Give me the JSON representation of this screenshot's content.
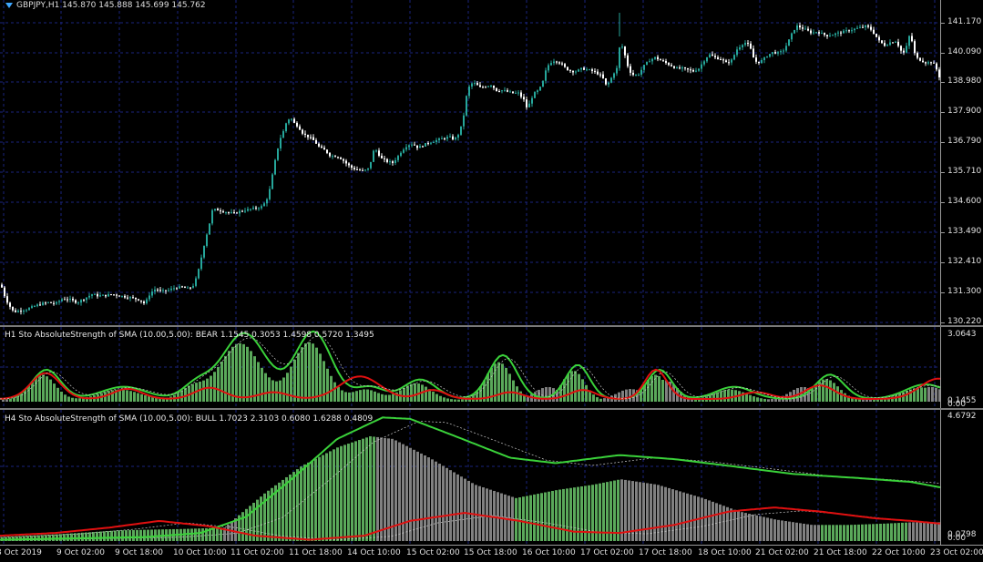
{
  "main_chart": {
    "symbol_line": "GBPJPY,H1  145.870 145.888 145.699 145.762",
    "price_ticks": [
      "141.170",
      "140.090",
      "138.980",
      "137.900",
      "136.790",
      "135.710",
      "134.600",
      "133.490",
      "132.410",
      "131.300",
      "130.220"
    ],
    "price_range": [
      130.1,
      141.9
    ]
  },
  "indicator_h1": {
    "label": "H1 Sto AbsoluteStrength of SMA (10.00,5.00): BEAR 1.1545 0.3053 1.4598 0.5720 1.3495",
    "ticks": [
      "3.0643",
      "0.1455",
      "0.00"
    ],
    "range": [
      0,
      3.0643
    ]
  },
  "indicator_h4": {
    "label": "H4 Sto AbsoluteStrength of SMA (10.00,5.00): BULL 1.7023 2.3103 0.6080 1.6288 0.4809",
    "ticks": [
      "4.6792",
      "0.0798",
      "0.00"
    ],
    "range": [
      0,
      4.6792
    ]
  },
  "time_axis": [
    "8 Oct 2019",
    "9 Oct 02:00",
    "9 Oct 18:00",
    "10 Oct 10:00",
    "11 Oct 02:00",
    "11 Oct 18:00",
    "14 Oct 10:00",
    "15 Oct 02:00",
    "15 Oct 18:00",
    "16 Oct 10:00",
    "17 Oct 02:00",
    "17 Oct 18:00",
    "18 Oct 10:00",
    "21 Oct 02:00",
    "21 Oct 18:00",
    "22 Oct 10:00",
    "23 Oct 02:00"
  ],
  "colors": {
    "background": "#000000",
    "grid": "#1a237e",
    "bull_candle": "#26a69a",
    "bear_candle": "#ffffff",
    "green_hist": "#5aa85a",
    "gray_hist": "#808080",
    "green_line": "#3ad13a",
    "red_line": "#e01010"
  },
  "chart_data": {
    "type": "candlestick",
    "title": "GBPJPY,H1",
    "ohlc_last": {
      "open": 145.87,
      "high": 145.888,
      "low": 145.699,
      "close": 145.762
    },
    "y_axis_ticks": [
      141.17,
      140.09,
      138.98,
      137.9,
      136.79,
      135.71,
      134.6,
      133.49,
      132.41,
      131.3,
      130.22
    ],
    "x_axis_ticks": [
      "8 Oct 2019",
      "9 Oct 02:00",
      "9 Oct 18:00",
      "10 Oct 10:00",
      "11 Oct 02:00",
      "11 Oct 18:00",
      "14 Oct 10:00",
      "15 Oct 02:00",
      "15 Oct 18:00",
      "16 Oct 10:00",
      "17 Oct 02:00",
      "17 Oct 18:00",
      "18 Oct 10:00",
      "21 Oct 02:00",
      "21 Oct 18:00",
      "22 Oct 10:00",
      "23 Oct 02:00"
    ],
    "close_path": [
      [
        0,
        131.6
      ],
      [
        4,
        131.2
      ],
      [
        8,
        130.9
      ],
      [
        14,
        130.6
      ],
      [
        20,
        130.65
      ],
      [
        28,
        130.7
      ],
      [
        36,
        130.8
      ],
      [
        44,
        130.9
      ],
      [
        52,
        130.95
      ],
      [
        60,
        130.9
      ],
      [
        68,
        131.1
      ],
      [
        76,
        131.05
      ],
      [
        84,
        130.95
      ],
      [
        92,
        131.1
      ],
      [
        100,
        131.25
      ],
      [
        106,
        131.2
      ],
      [
        114,
        131.2
      ],
      [
        122,
        131.25
      ],
      [
        130,
        131.2
      ],
      [
        138,
        131.15
      ],
      [
        146,
        131.1
      ],
      [
        152,
        131.05
      ],
      [
        158,
        130.9
      ],
      [
        164,
        131.3
      ],
      [
        170,
        131.45
      ],
      [
        176,
        131.35
      ],
      [
        184,
        131.4
      ],
      [
        192,
        131.5
      ],
      [
        200,
        131.5
      ],
      [
        206,
        131.45
      ],
      [
        212,
        131.6
      ],
      [
        216,
        132.0
      ],
      [
        220,
        132.6
      ],
      [
        224,
        133.2
      ],
      [
        228,
        133.7
      ],
      [
        232,
        134.3
      ],
      [
        236,
        134.35
      ],
      [
        242,
        134.3
      ],
      [
        248,
        134.25
      ],
      [
        256,
        134.2
      ],
      [
        264,
        134.3
      ],
      [
        272,
        134.35
      ],
      [
        280,
        134.4
      ],
      [
        286,
        134.45
      ],
      [
        290,
        134.6
      ],
      [
        294,
        134.9
      ],
      [
        298,
        135.6
      ],
      [
        302,
        136.3
      ],
      [
        306,
        136.9
      ],
      [
        310,
        137.2
      ],
      [
        314,
        137.6
      ],
      [
        318,
        137.7
      ],
      [
        322,
        137.5
      ],
      [
        326,
        137.4
      ],
      [
        332,
        137.1
      ],
      [
        338,
        137.0
      ],
      [
        344,
        136.85
      ],
      [
        350,
        136.6
      ],
      [
        356,
        136.5
      ],
      [
        362,
        136.3
      ],
      [
        368,
        136.3
      ],
      [
        374,
        136.2
      ],
      [
        380,
        136.0
      ],
      [
        386,
        135.85
      ],
      [
        392,
        135.8
      ],
      [
        398,
        135.75
      ],
      [
        404,
        135.85
      ],
      [
        410,
        136.6
      ],
      [
        414,
        136.4
      ],
      [
        418,
        136.2
      ],
      [
        424,
        136.1
      ],
      [
        430,
        136.05
      ],
      [
        436,
        136.3
      ],
      [
        440,
        136.5
      ],
      [
        446,
        136.7
      ],
      [
        452,
        136.75
      ],
      [
        458,
        136.6
      ],
      [
        464,
        136.7
      ],
      [
        470,
        136.8
      ],
      [
        476,
        136.85
      ],
      [
        480,
        136.9
      ],
      [
        486,
        136.95
      ],
      [
        492,
        137.0
      ],
      [
        498,
        136.9
      ],
      [
        504,
        137.2
      ],
      [
        508,
        137.8
      ],
      [
        512,
        138.7
      ],
      [
        516,
        138.95
      ],
      [
        520,
        138.95
      ],
      [
        526,
        138.8
      ],
      [
        532,
        138.85
      ],
      [
        538,
        138.9
      ],
      [
        544,
        138.7
      ],
      [
        550,
        138.7
      ],
      [
        556,
        138.65
      ],
      [
        562,
        138.6
      ],
      [
        568,
        138.6
      ],
      [
        574,
        138.35
      ],
      [
        578,
        138.0
      ],
      [
        582,
        138.4
      ],
      [
        586,
        138.6
      ],
      [
        590,
        138.7
      ],
      [
        594,
        138.9
      ],
      [
        598,
        139.4
      ],
      [
        602,
        139.7
      ],
      [
        608,
        139.8
      ],
      [
        614,
        139.7
      ],
      [
        620,
        139.5
      ],
      [
        626,
        139.4
      ],
      [
        632,
        139.4
      ],
      [
        638,
        139.5
      ],
      [
        644,
        139.45
      ],
      [
        650,
        139.4
      ],
      [
        656,
        139.3
      ],
      [
        660,
        139.2
      ],
      [
        664,
        138.9
      ],
      [
        668,
        139.0
      ],
      [
        672,
        139.3
      ],
      [
        676,
        139.5
      ],
      [
        680,
        140.5
      ],
      [
        684,
        140.1
      ],
      [
        688,
        139.6
      ],
      [
        692,
        139.3
      ],
      [
        696,
        139.25
      ],
      [
        700,
        139.3
      ],
      [
        706,
        139.6
      ],
      [
        712,
        139.8
      ],
      [
        718,
        139.9
      ],
      [
        724,
        139.8
      ],
      [
        730,
        139.7
      ],
      [
        736,
        139.6
      ],
      [
        742,
        139.5
      ],
      [
        748,
        139.5
      ],
      [
        754,
        139.45
      ],
      [
        760,
        139.4
      ],
      [
        766,
        139.5
      ],
      [
        770,
        139.7
      ],
      [
        774,
        139.9
      ],
      [
        778,
        140.0
      ],
      [
        784,
        139.9
      ],
      [
        790,
        139.85
      ],
      [
        796,
        139.7
      ],
      [
        802,
        139.8
      ],
      [
        808,
        140.2
      ],
      [
        814,
        140.4
      ],
      [
        818,
        140.45
      ],
      [
        822,
        140.3
      ],
      [
        826,
        139.9
      ],
      [
        830,
        139.7
      ],
      [
        836,
        139.8
      ],
      [
        842,
        140.0
      ],
      [
        848,
        140.1
      ],
      [
        854,
        140.05
      ],
      [
        860,
        140.2
      ],
      [
        866,
        140.6
      ],
      [
        870,
        140.9
      ],
      [
        874,
        141.05
      ],
      [
        878,
        141.0
      ],
      [
        884,
        140.9
      ],
      [
        890,
        140.8
      ],
      [
        896,
        140.85
      ],
      [
        902,
        140.75
      ],
      [
        908,
        140.7
      ],
      [
        914,
        140.75
      ],
      [
        920,
        140.8
      ],
      [
        926,
        140.85
      ],
      [
        932,
        140.9
      ],
      [
        938,
        140.95
      ],
      [
        944,
        141.0
      ],
      [
        950,
        141.05
      ],
      [
        956,
        140.9
      ],
      [
        960,
        140.7
      ],
      [
        964,
        140.5
      ],
      [
        970,
        140.35
      ],
      [
        976,
        140.45
      ],
      [
        982,
        140.5
      ],
      [
        986,
        140.3
      ],
      [
        990,
        140.0
      ],
      [
        994,
        140.3
      ],
      [
        998,
        140.8
      ],
      [
        1000,
        140.5
      ],
      [
        1004,
        139.9
      ],
      [
        1010,
        139.8
      ],
      [
        1016,
        139.7
      ],
      [
        1022,
        139.75
      ],
      [
        1026,
        139.55
      ],
      [
        1030,
        139.2
      ]
    ]
  }
}
